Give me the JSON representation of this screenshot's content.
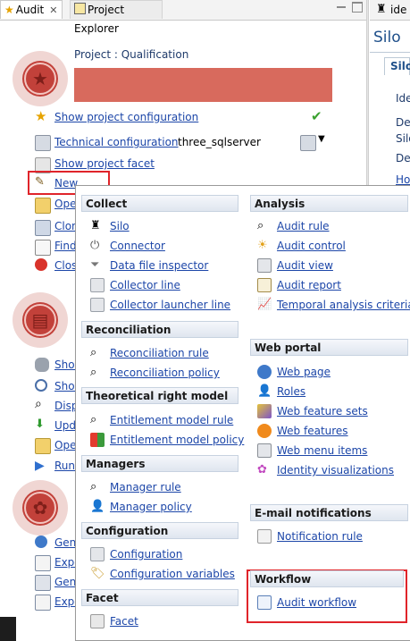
{
  "tabs": {
    "audit": "Audit",
    "audit_close": "✕",
    "project_explorer": "Project Explorer",
    "right_tab": "ide"
  },
  "right_panel": {
    "title": "Silo",
    "subtab": "Silo",
    "labels": [
      "Ide",
      "De",
      "Silo",
      "De",
      "Ho"
    ]
  },
  "project": {
    "label": "Project : Qualification",
    "links": {
      "show_config": "Show project configuration",
      "technical_config": "Technical configuration",
      "technical_value": "three_sqlserver",
      "show_facet": "Show project facet",
      "new": "New"
    },
    "truncated_links": [
      "Ope",
      "Clon",
      "Find",
      "Clos"
    ],
    "section2_links": [
      "Shov",
      "Shov",
      "Disp",
      "Upd",
      "Ope",
      "Run"
    ],
    "section3_links": [
      "Gen",
      "Expo",
      "Gen",
      "Expo"
    ]
  },
  "menu": {
    "collect": {
      "title": "Collect",
      "items": [
        "Silo",
        "Connector",
        "Data file inspector",
        "Collector line",
        "Collector launcher line"
      ]
    },
    "reconciliation": {
      "title": "Reconciliation",
      "items": [
        "Reconciliation rule",
        "Reconciliation policy"
      ]
    },
    "theoretical": {
      "title": "Theoretical right model",
      "items": [
        "Entitlement model rule",
        "Entitlement model policy"
      ]
    },
    "managers": {
      "title": "Managers",
      "items": [
        "Manager rule",
        "Manager policy"
      ]
    },
    "configuration": {
      "title": "Configuration",
      "items": [
        "Configuration",
        "Configuration variables"
      ]
    },
    "facet": {
      "title": "Facet",
      "items": [
        "Facet"
      ]
    },
    "analysis": {
      "title": "Analysis",
      "items": [
        "Audit rule",
        "Audit control",
        "Audit view",
        "Audit report",
        "Temporal analysis criteria"
      ]
    },
    "web_portal": {
      "title": "Web portal",
      "items": [
        "Web page",
        "Roles",
        "Web feature sets",
        "Web features",
        "Web menu items",
        "Identity visualizations"
      ]
    },
    "email": {
      "title": "E-mail notifications",
      "items": [
        "Notification rule"
      ]
    },
    "workflow": {
      "title": "Workflow",
      "items": [
        "Audit workflow"
      ]
    }
  },
  "colors": {
    "accent_red": "#c2413a",
    "highlight_red": "#e0242a",
    "link_blue": "#1c46a8",
    "check_green": "#3aa12f"
  }
}
